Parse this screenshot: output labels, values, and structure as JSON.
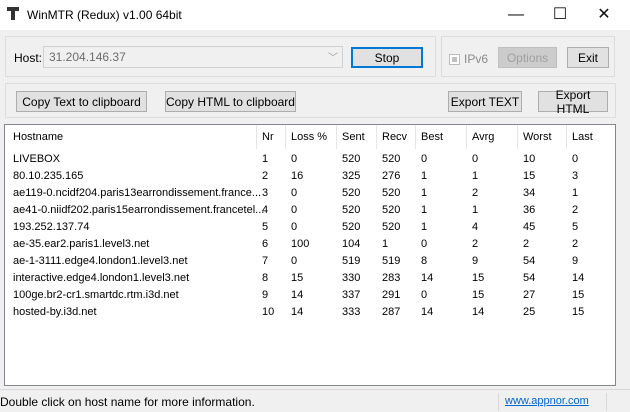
{
  "window": {
    "title": "WinMTR (Redux) v1.00 64bit",
    "minimize": "—",
    "maximize": "☐",
    "close": "✕"
  },
  "toolbar": {
    "host_label": "Host:",
    "host_value": "31.204.146.37",
    "stop": "Stop",
    "ipv6": "IPv6",
    "options": "Options",
    "exit": "Exit",
    "copy_text": "Copy Text to clipboard",
    "copy_html": "Copy HTML to clipboard",
    "export_text": "Export TEXT",
    "export_html": "Export HTML"
  },
  "table": {
    "columns": [
      "Hostname",
      "Nr",
      "Loss %",
      "Sent",
      "Recv",
      "Best",
      "Avrg",
      "Worst",
      "Last"
    ],
    "rows": [
      [
        "LIVEBOX",
        "1",
        "0",
        "520",
        "520",
        "0",
        "0",
        "10",
        "0"
      ],
      [
        "80.10.235.165",
        "2",
        "16",
        "325",
        "276",
        "1",
        "1",
        "15",
        "3"
      ],
      [
        "ae119-0.ncidf204.paris13earrondissement.france...",
        "3",
        "0",
        "520",
        "520",
        "1",
        "2",
        "34",
        "1"
      ],
      [
        "ae41-0.niidf202.paris15earrondissement.francetel...",
        "4",
        "0",
        "520",
        "520",
        "1",
        "1",
        "36",
        "2"
      ],
      [
        "193.252.137.74",
        "5",
        "0",
        "520",
        "520",
        "1",
        "4",
        "45",
        "5"
      ],
      [
        "ae-35.ear2.paris1.level3.net",
        "6",
        "100",
        "104",
        "1",
        "0",
        "2",
        "2",
        "2"
      ],
      [
        "ae-1-3111.edge4.london1.level3.net",
        "7",
        "0",
        "519",
        "519",
        "8",
        "9",
        "54",
        "9"
      ],
      [
        "interactive.edge4.london1.level3.net",
        "8",
        "15",
        "330",
        "283",
        "14",
        "15",
        "54",
        "14"
      ],
      [
        "100ge.br2-cr1.smartdc.rtm.i3d.net",
        "9",
        "14",
        "337",
        "291",
        "0",
        "15",
        "27",
        "15"
      ],
      [
        "hosted-by.i3d.net",
        "10",
        "14",
        "333",
        "287",
        "14",
        "14",
        "25",
        "15"
      ]
    ]
  },
  "status": {
    "text": "Double click on host name for more information.",
    "link": "www.appnor.com"
  }
}
